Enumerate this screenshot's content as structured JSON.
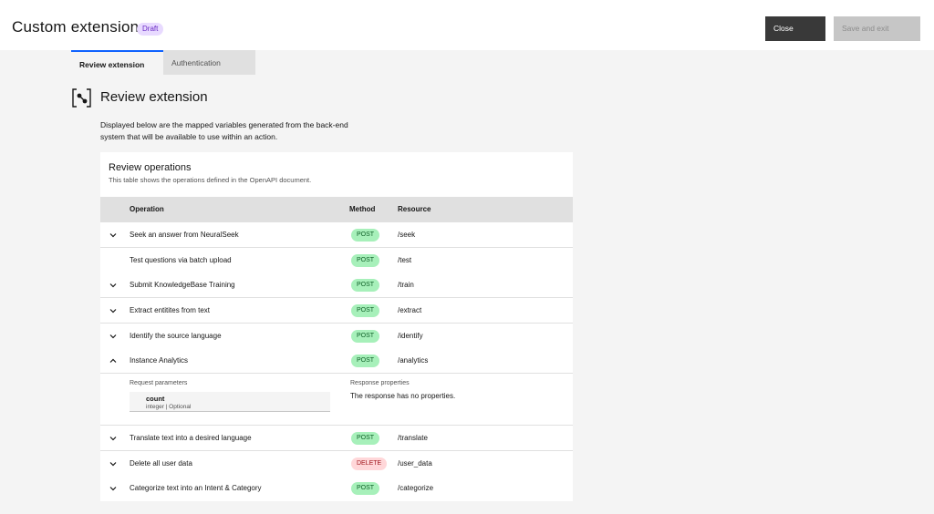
{
  "header": {
    "title": "Custom extension",
    "badge": "Draft",
    "close_label": "Close",
    "save_label": "Save and exit"
  },
  "tabs": [
    {
      "label": "Review extension",
      "selected": true
    },
    {
      "label": "Authentication",
      "selected": false
    }
  ],
  "section": {
    "icon": "review-extension-icon",
    "title": "Review extension",
    "description": "Displayed below are the mapped variables generated from the back-end system that will be available to use within an action."
  },
  "operations": {
    "title": "Review operations",
    "subtitle": "This table shows the operations defined in the OpenAPI document.",
    "columns": {
      "operation": "Operation",
      "method": "Method",
      "resource": "Resource"
    },
    "rows": [
      {
        "operation": "Seek an answer from NeuralSeek",
        "method": "POST",
        "resource": "/seek",
        "chevron": "chevron-down-icon"
      },
      {
        "operation": "Test questions via batch upload",
        "method": "POST",
        "resource": "/test",
        "chevron": ""
      },
      {
        "operation": "Submit KnowledgeBase Training",
        "method": "POST",
        "resource": "/train",
        "chevron": "chevron-down-icon"
      },
      {
        "operation": "Extract entitites from text",
        "method": "POST",
        "resource": "/extract",
        "chevron": "chevron-down-icon"
      },
      {
        "operation": "Identify the source language",
        "method": "POST",
        "resource": "/identify",
        "chevron": "chevron-down-icon"
      },
      {
        "operation": "Instance Analytics",
        "method": "POST",
        "resource": "/analytics",
        "chevron": "chevron-up-icon"
      },
      {
        "operation": "Translate text into a desired language",
        "method": "POST",
        "resource": "/translate",
        "chevron": "chevron-down-icon"
      },
      {
        "operation": "Delete all user data",
        "method": "DELETE",
        "resource": "/user_data",
        "chevron": "chevron-down-icon"
      },
      {
        "operation": "Categorize text into an Intent & Category",
        "method": "POST",
        "resource": "/categorize",
        "chevron": "chevron-down-icon"
      }
    ],
    "expanded": {
      "request_label": "Request parameters",
      "param_name": "count",
      "param_meta": "integer | Optional",
      "response_label": "Response properties",
      "response_text": "The response has no properties."
    }
  }
}
